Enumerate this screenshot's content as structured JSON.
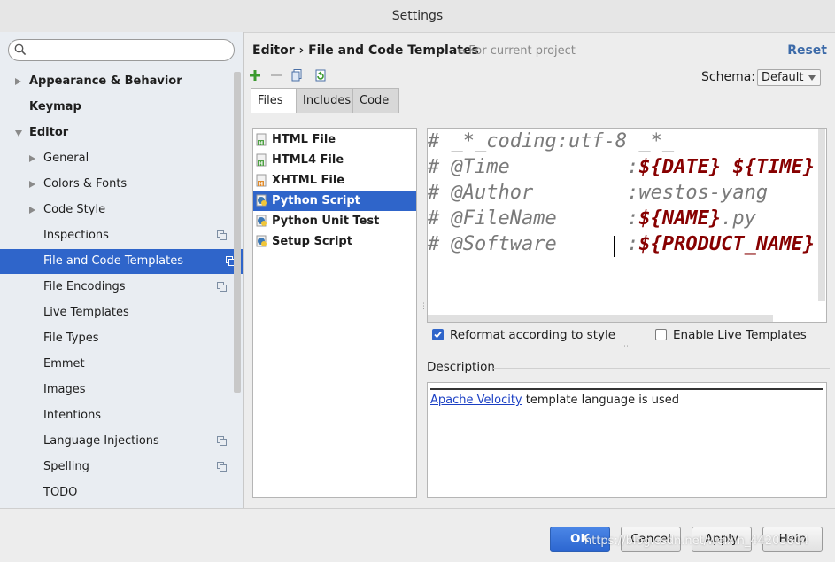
{
  "window": {
    "title": "Settings"
  },
  "search": {
    "value": "",
    "placeholder": ""
  },
  "sidebar": {
    "items": [
      {
        "label": "Appearance & Behavior",
        "level": 0,
        "bold": true,
        "arrow": "right",
        "project": false,
        "selected": false
      },
      {
        "label": "Keymap",
        "level": 0,
        "bold": true,
        "arrow": "",
        "project": false,
        "selected": false
      },
      {
        "label": "Editor",
        "level": 0,
        "bold": true,
        "arrow": "down",
        "project": false,
        "selected": false
      },
      {
        "label": "General",
        "level": 1,
        "bold": false,
        "arrow": "right",
        "project": false,
        "selected": false
      },
      {
        "label": "Colors & Fonts",
        "level": 1,
        "bold": false,
        "arrow": "right",
        "project": false,
        "selected": false
      },
      {
        "label": "Code Style",
        "level": 1,
        "bold": false,
        "arrow": "right",
        "project": false,
        "selected": false
      },
      {
        "label": "Inspections",
        "level": 1,
        "bold": false,
        "arrow": "",
        "project": true,
        "selected": false
      },
      {
        "label": "File and Code Templates",
        "level": 1,
        "bold": false,
        "arrow": "",
        "project": true,
        "selected": true
      },
      {
        "label": "File Encodings",
        "level": 1,
        "bold": false,
        "arrow": "",
        "project": true,
        "selected": false
      },
      {
        "label": "Live Templates",
        "level": 1,
        "bold": false,
        "arrow": "",
        "project": false,
        "selected": false
      },
      {
        "label": "File Types",
        "level": 1,
        "bold": false,
        "arrow": "",
        "project": false,
        "selected": false
      },
      {
        "label": "Emmet",
        "level": 1,
        "bold": false,
        "arrow": "",
        "project": false,
        "selected": false
      },
      {
        "label": "Images",
        "level": 1,
        "bold": false,
        "arrow": "",
        "project": false,
        "selected": false
      },
      {
        "label": "Intentions",
        "level": 1,
        "bold": false,
        "arrow": "",
        "project": false,
        "selected": false
      },
      {
        "label": "Language Injections",
        "level": 1,
        "bold": false,
        "arrow": "",
        "project": true,
        "selected": false
      },
      {
        "label": "Spelling",
        "level": 1,
        "bold": false,
        "arrow": "",
        "project": true,
        "selected": false
      },
      {
        "label": "TODO",
        "level": 1,
        "bold": false,
        "arrow": "",
        "project": false,
        "selected": false
      }
    ]
  },
  "header": {
    "breadcrumb": "Editor › File and Code Templates",
    "scope_note": "For current project",
    "reset_label": "Reset"
  },
  "toolbar": {
    "icons": [
      "add-icon",
      "remove-icon",
      "copy-icon",
      "reset-icon"
    ]
  },
  "schema": {
    "label": "Schema:",
    "value": "Default"
  },
  "tabs": [
    {
      "label": "Files",
      "active": true
    },
    {
      "label": "Includes",
      "active": false
    },
    {
      "label": "Code",
      "active": false
    }
  ],
  "templates": [
    {
      "name": "HTML File",
      "icon": "html-file-icon",
      "selected": false
    },
    {
      "name": "HTML4 File",
      "icon": "html-file-icon",
      "selected": false
    },
    {
      "name": "XHTML File",
      "icon": "xhtml-file-icon",
      "selected": false
    },
    {
      "name": "Python Script",
      "icon": "python-file-icon",
      "selected": true
    },
    {
      "name": "Python Unit Test",
      "icon": "python-file-icon",
      "selected": false
    },
    {
      "name": "Setup Script",
      "icon": "python-file-icon",
      "selected": false
    }
  ],
  "editor": {
    "lines": [
      [
        {
          "t": "# _*_coding:utf-8 _*_",
          "c": ""
        }
      ],
      [
        {
          "t": "# @Time          :",
          "c": ""
        },
        {
          "t": "${DATE} ${TIME}",
          "c": "v"
        }
      ],
      [
        {
          "t": "# @Author        :westos-yang",
          "c": ""
        }
      ],
      [
        {
          "t": "# @FileName      :",
          "c": ""
        },
        {
          "t": "${NAME}",
          "c": "v"
        },
        {
          "t": ".py",
          "c": ""
        }
      ],
      [
        {
          "t": "# @Software      :",
          "c": ""
        },
        {
          "t": "${PRODUCT_NAME}",
          "c": "v"
        }
      ]
    ]
  },
  "options": {
    "reformat": {
      "label": "Reformat according to style",
      "checked": true
    },
    "live_templates": {
      "label": "Enable Live Templates",
      "checked": false
    }
  },
  "description": {
    "title": "Description",
    "link_text": "Apache Velocity",
    "rest_text": " template language is used"
  },
  "buttons": {
    "ok": "OK",
    "cancel": "Cancel",
    "apply": "Apply",
    "help": "Help"
  },
  "watermark": "https://blog.csdn.net/weixin_44203804",
  "colors": {
    "selection": "#2f65ca",
    "template_var": "#870000",
    "link": "#1a3fc4"
  }
}
